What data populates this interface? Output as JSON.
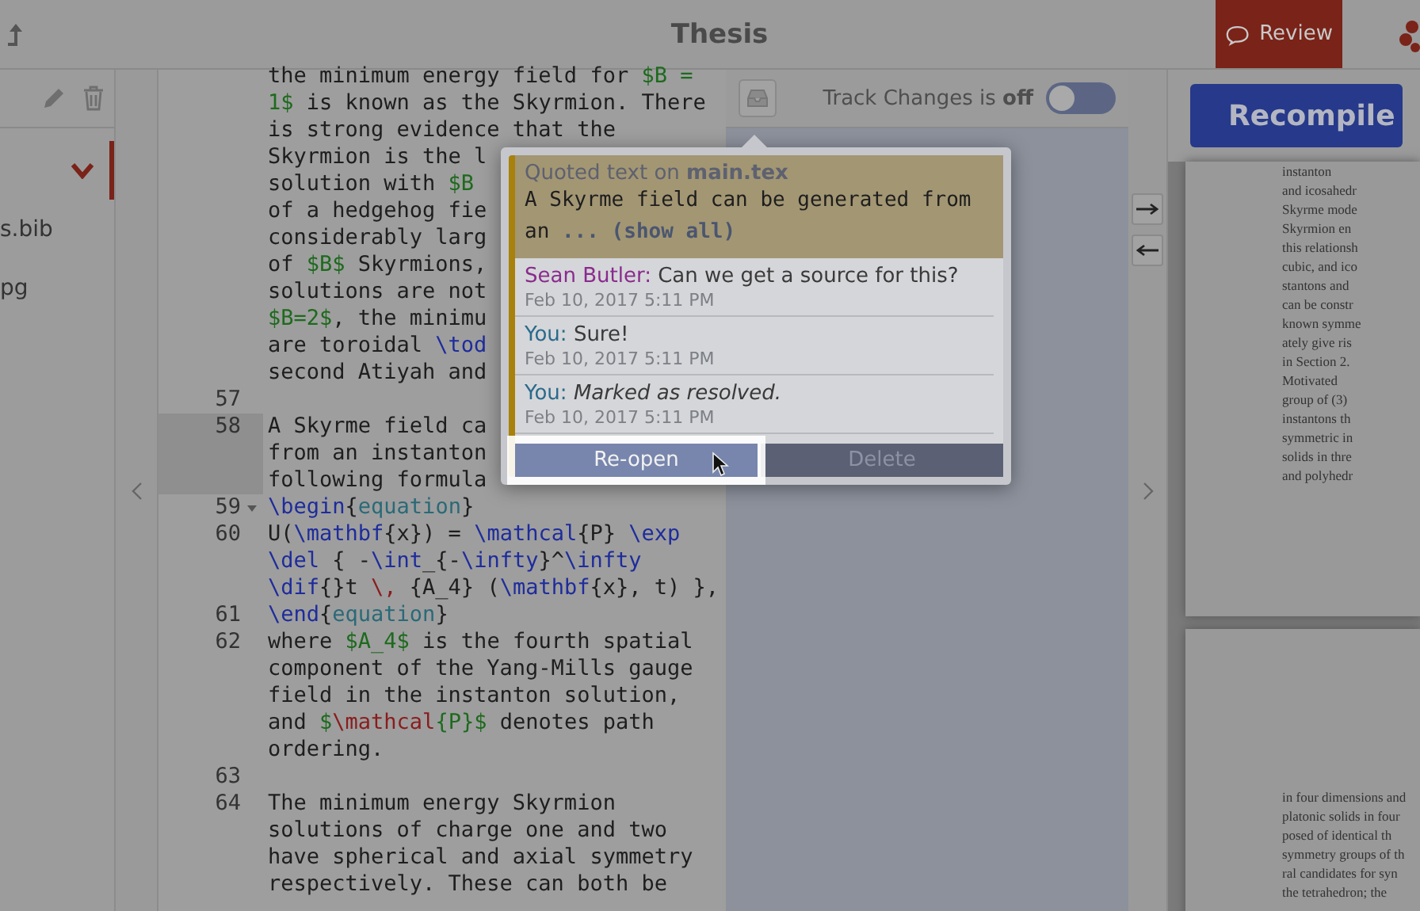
{
  "top_bar": {
    "title": "Thesis",
    "review_button": {
      "label": "Review",
      "selected": true
    }
  },
  "sidebar": {
    "files": [
      {
        "kind": "folder",
        "expanded": true,
        "selected": true
      },
      {
        "kind": "file",
        "name": "s.bib"
      },
      {
        "kind": "file",
        "name": "pg"
      }
    ]
  },
  "editor": {
    "lines": [
      {
        "rows": [
          {
            "segments": [
              {
                "text": "the minimum energy field for ",
                "kind": "plain"
              },
              {
                "text": "$B =",
                "kind": "math"
              }
            ]
          },
          {
            "segments": [
              {
                "text": "1$",
                "kind": "math"
              },
              {
                "text": " is known as the Skyrmion. There",
                "kind": "plain"
              }
            ]
          },
          {
            "segments": [
              {
                "text": "is strong evidence that the",
                "kind": "plain"
              }
            ]
          },
          {
            "segments": [
              {
                "text": "Skyrmion is the l",
                "kind": "plain"
              }
            ]
          },
          {
            "segments": [
              {
                "text": "solution with ",
                "kind": "plain"
              },
              {
                "text": "$B",
                "kind": "math"
              }
            ]
          },
          {
            "segments": [
              {
                "text": "of a hedgehog fie",
                "kind": "plain"
              }
            ]
          },
          {
            "segments": [
              {
                "text": "considerably larg",
                "kind": "plain"
              }
            ]
          },
          {
            "segments": [
              {
                "text": "of ",
                "kind": "plain"
              },
              {
                "text": "$B$",
                "kind": "math"
              },
              {
                "text": " Skyrmions,",
                "kind": "plain"
              }
            ]
          },
          {
            "segments": [
              {
                "text": "solutions are not",
                "kind": "plain"
              }
            ]
          },
          {
            "segments": [
              {
                "text": "$B=2$",
                "kind": "math"
              },
              {
                "text": ", the minimu",
                "kind": "plain"
              }
            ]
          },
          {
            "segments": [
              {
                "text": "are toroidal ",
                "kind": "plain"
              },
              {
                "text": "\\tod",
                "kind": "cmd"
              }
            ]
          },
          {
            "segments": [
              {
                "text": "second Atiyah and",
                "kind": "plain"
              }
            ]
          }
        ],
        "active": false,
        "fold": false
      },
      {
        "number": "57",
        "active": false,
        "fold": false
      },
      {
        "number": "58",
        "rows": [
          {
            "segments": [
              {
                "text": "A Skyrme field ca",
                "kind": "plain"
              }
            ]
          },
          {
            "segments": [
              {
                "text": "from an instanton",
                "kind": "plain"
              }
            ]
          },
          {
            "segments": [
              {
                "text": "following formula",
                "kind": "plain"
              }
            ]
          }
        ],
        "active": true,
        "fold": false
      },
      {
        "number": "59",
        "rows": [
          {
            "segments": [
              {
                "text": "\\begin",
                "kind": "cmd"
              },
              {
                "text": "{",
                "kind": "plain"
              },
              {
                "text": "equation",
                "kind": "arg"
              },
              {
                "text": "}",
                "kind": "plain"
              }
            ]
          }
        ],
        "active": false,
        "fold": true
      },
      {
        "number": "60",
        "rows": [
          {
            "segments": [
              {
                "text": "U(",
                "kind": "plain"
              },
              {
                "text": "\\mathbf",
                "kind": "cmd"
              },
              {
                "text": "{x}) = ",
                "kind": "plain"
              },
              {
                "text": "\\mathcal",
                "kind": "cmd"
              },
              {
                "text": "{P} ",
                "kind": "plain"
              },
              {
                "text": "\\exp",
                "kind": "cmd"
              }
            ]
          },
          {
            "segments": [
              {
                "text": "\\del",
                "kind": "cmd"
              },
              {
                "text": " { -",
                "kind": "plain"
              },
              {
                "text": "\\int",
                "kind": "cmd"
              },
              {
                "text": "_{-",
                "kind": "plain"
              },
              {
                "text": "\\infty",
                "kind": "cmd"
              },
              {
                "text": "}^",
                "kind": "plain"
              },
              {
                "text": "\\infty",
                "kind": "cmd"
              }
            ]
          },
          {
            "segments": [
              {
                "text": "\\dif",
                "kind": "cmd"
              },
              {
                "text": "{}t ",
                "kind": "plain"
              },
              {
                "text": "\\,",
                "kind": "red"
              },
              {
                "text": " {A_4} (",
                "kind": "plain"
              },
              {
                "text": "\\mathbf",
                "kind": "cmd"
              },
              {
                "text": "{x}, t) },",
                "kind": "plain"
              }
            ]
          }
        ],
        "active": false,
        "fold": false
      },
      {
        "number": "61",
        "rows": [
          {
            "segments": [
              {
                "text": "\\end",
                "kind": "cmd"
              },
              {
                "text": "{",
                "kind": "plain"
              },
              {
                "text": "equation",
                "kind": "arg"
              },
              {
                "text": "}",
                "kind": "plain"
              }
            ]
          }
        ],
        "active": false,
        "fold": false
      },
      {
        "number": "62",
        "rows": [
          {
            "segments": [
              {
                "text": "where ",
                "kind": "plain"
              },
              {
                "text": "$A_4$",
                "kind": "math"
              },
              {
                "text": " is the fourth spatial",
                "kind": "plain"
              }
            ]
          },
          {
            "segments": [
              {
                "text": "component of the Yang-Mills gauge",
                "kind": "plain"
              }
            ]
          },
          {
            "segments": [
              {
                "text": "field in the instanton solution,",
                "kind": "plain"
              }
            ]
          },
          {
            "segments": [
              {
                "text": "and ",
                "kind": "plain"
              },
              {
                "text": "$",
                "kind": "math"
              },
              {
                "text": "\\mathcal",
                "kind": "red"
              },
              {
                "text": "{P}$",
                "kind": "math"
              },
              {
                "text": " denotes path",
                "kind": "plain"
              }
            ]
          },
          {
            "segments": [
              {
                "text": "ordering.",
                "kind": "plain"
              }
            ]
          }
        ],
        "active": false,
        "fold": false
      },
      {
        "number": "63",
        "active": false,
        "fold": false
      },
      {
        "number": "64",
        "rows": [
          {
            "segments": [
              {
                "text": "The minimum energy Skyrmion",
                "kind": "plain"
              }
            ]
          },
          {
            "segments": [
              {
                "text": "solutions of charge one and two",
                "kind": "plain"
              }
            ]
          },
          {
            "segments": [
              {
                "text": "have spherical and axial symmetry",
                "kind": "plain"
              }
            ]
          },
          {
            "segments": [
              {
                "text": "respectively. These can both be",
                "kind": "plain"
              }
            ]
          }
        ],
        "active": false,
        "fold": false
      }
    ]
  },
  "review_panel": {
    "track_changes": {
      "label": "Track Changes is **off**",
      "on": false
    },
    "popup": {
      "quote_header": "Quoted text on **main.tex**",
      "quote_text": "A Skyrme field can be generated from an",
      "show_all": "... (show all)",
      "messages": [
        {
          "author": "Sean Butler:",
          "text": "Can we get a source for this?",
          "date": "Feb 10, 2017 5:11 PM",
          "kind": "comment",
          "color": "#8a2a8e"
        },
        {
          "author": "You:",
          "text": "Sure!",
          "date": "Feb 10, 2017 5:11 PM",
          "kind": "comment",
          "color": "#2a6a8c"
        },
        {
          "author": "You:",
          "text": "Marked as resolved.",
          "date": "Feb 10, 2017 5:11 PM",
          "kind": "status",
          "color": "#2a6a8c"
        }
      ],
      "buttons": [
        {
          "label": "Re-open",
          "highlighted": true
        },
        {
          "label": "Delete",
          "highlighted": false
        }
      ]
    }
  },
  "pdf": {
    "recompile": "Recompile",
    "pages": [
      {
        "lines": [
          "instanton",
          "and icosahedr",
          "Skyrme mode",
          "Skyrmion en",
          "this relationsh",
          "cubic, and ico",
          "stantons and",
          "can be constr",
          "known symme",
          "ately give ris",
          "in Section 2.",
          "Motivated",
          "group of (3)",
          "instantons th",
          "symmetric in",
          "solids in thre",
          "and polyhedr"
        ]
      },
      {
        "lines": [
          "in four dimensions and",
          "platonic solids in four",
          "posed of identical th",
          "symmetry groups of th",
          "ral candidates for syn",
          "the tetrahedron; the"
        ]
      }
    ]
  }
}
